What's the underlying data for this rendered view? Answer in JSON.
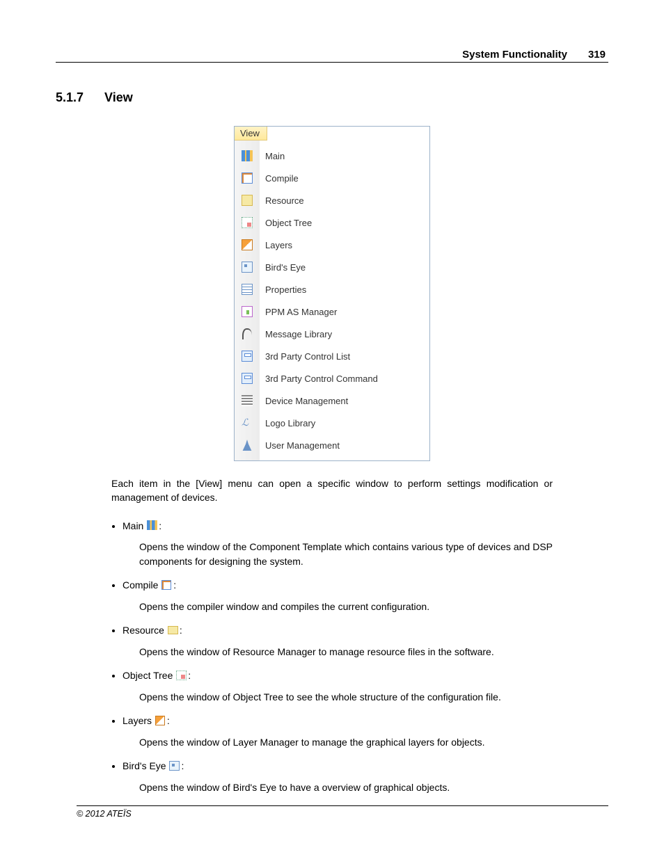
{
  "header": {
    "chapter": "System Functionality",
    "page_number": "319"
  },
  "section": {
    "number": "5.1.7",
    "title": "View"
  },
  "menu": {
    "title": "View",
    "items": [
      "Main",
      "Compile",
      "Resource",
      "Object Tree",
      "Layers",
      "Bird's Eye",
      "Properties",
      "PPM AS Manager",
      "Message Library",
      "3rd Party Control List",
      "3rd Party Control Command",
      "Device Management",
      "Logo Library",
      "User Management"
    ]
  },
  "intro_paragraph": "Each item in the [View] menu can open a specific window to perform settings modification or management of devices.",
  "bullet_items": [
    {
      "label": "Main",
      "description": "Opens the window of the Component Template which contains various type of devices and DSP components for designing the system."
    },
    {
      "label": "Compile",
      "description": "Opens the compiler window and compiles the current configuration."
    },
    {
      "label": "Resource",
      "description": "Opens the window of Resource Manager to manage resource files in the software."
    },
    {
      "label": "Object Tree",
      "description": "Opens the window of Object Tree to see the whole structure of the configuration file."
    },
    {
      "label": "Layers",
      "description": "Opens the window of Layer Manager to manage the graphical layers for objects."
    },
    {
      "label": "Bird's Eye",
      "description": "Opens the window of Bird's Eye to have a overview of graphical objects."
    }
  ],
  "footer": "© 2012 ATEÏS"
}
